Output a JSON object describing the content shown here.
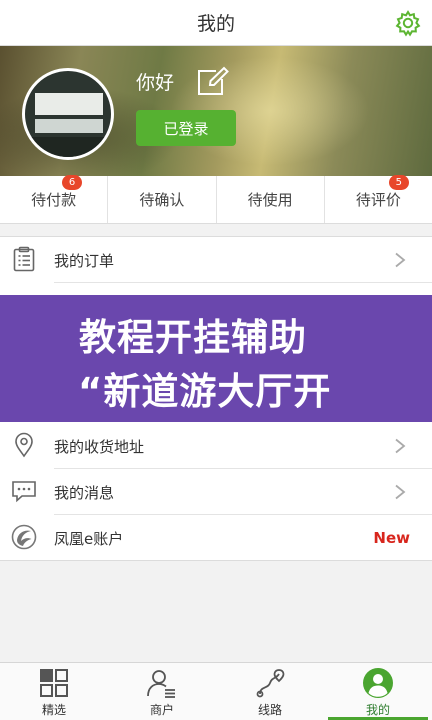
{
  "header": {
    "title": "我的"
  },
  "profile": {
    "greeting": "你好",
    "login_label": "已登录"
  },
  "order_status": [
    {
      "label": "待付款",
      "badge": "6"
    },
    {
      "label": "待确认",
      "badge": ""
    },
    {
      "label": "待使用",
      "badge": ""
    },
    {
      "label": "待评价",
      "badge": "5"
    }
  ],
  "menu": [
    {
      "label": "我的订单",
      "right": ""
    },
    {
      "label": "我的收货地址",
      "right": ""
    },
    {
      "label": "我的消息",
      "right": ""
    },
    {
      "label": "凤凰e账户",
      "right": "New"
    }
  ],
  "promo": {
    "line1": "教程开挂辅助",
    "line2": "“新道游大厅开"
  },
  "bottom_nav": [
    {
      "label": "精选"
    },
    {
      "label": "商户"
    },
    {
      "label": "线路"
    },
    {
      "label": "我的"
    }
  ],
  "colors": {
    "accent": "#56b131",
    "badge": "#e8462a",
    "promo_bg": "#6a47ad",
    "new": "#d8261d"
  }
}
